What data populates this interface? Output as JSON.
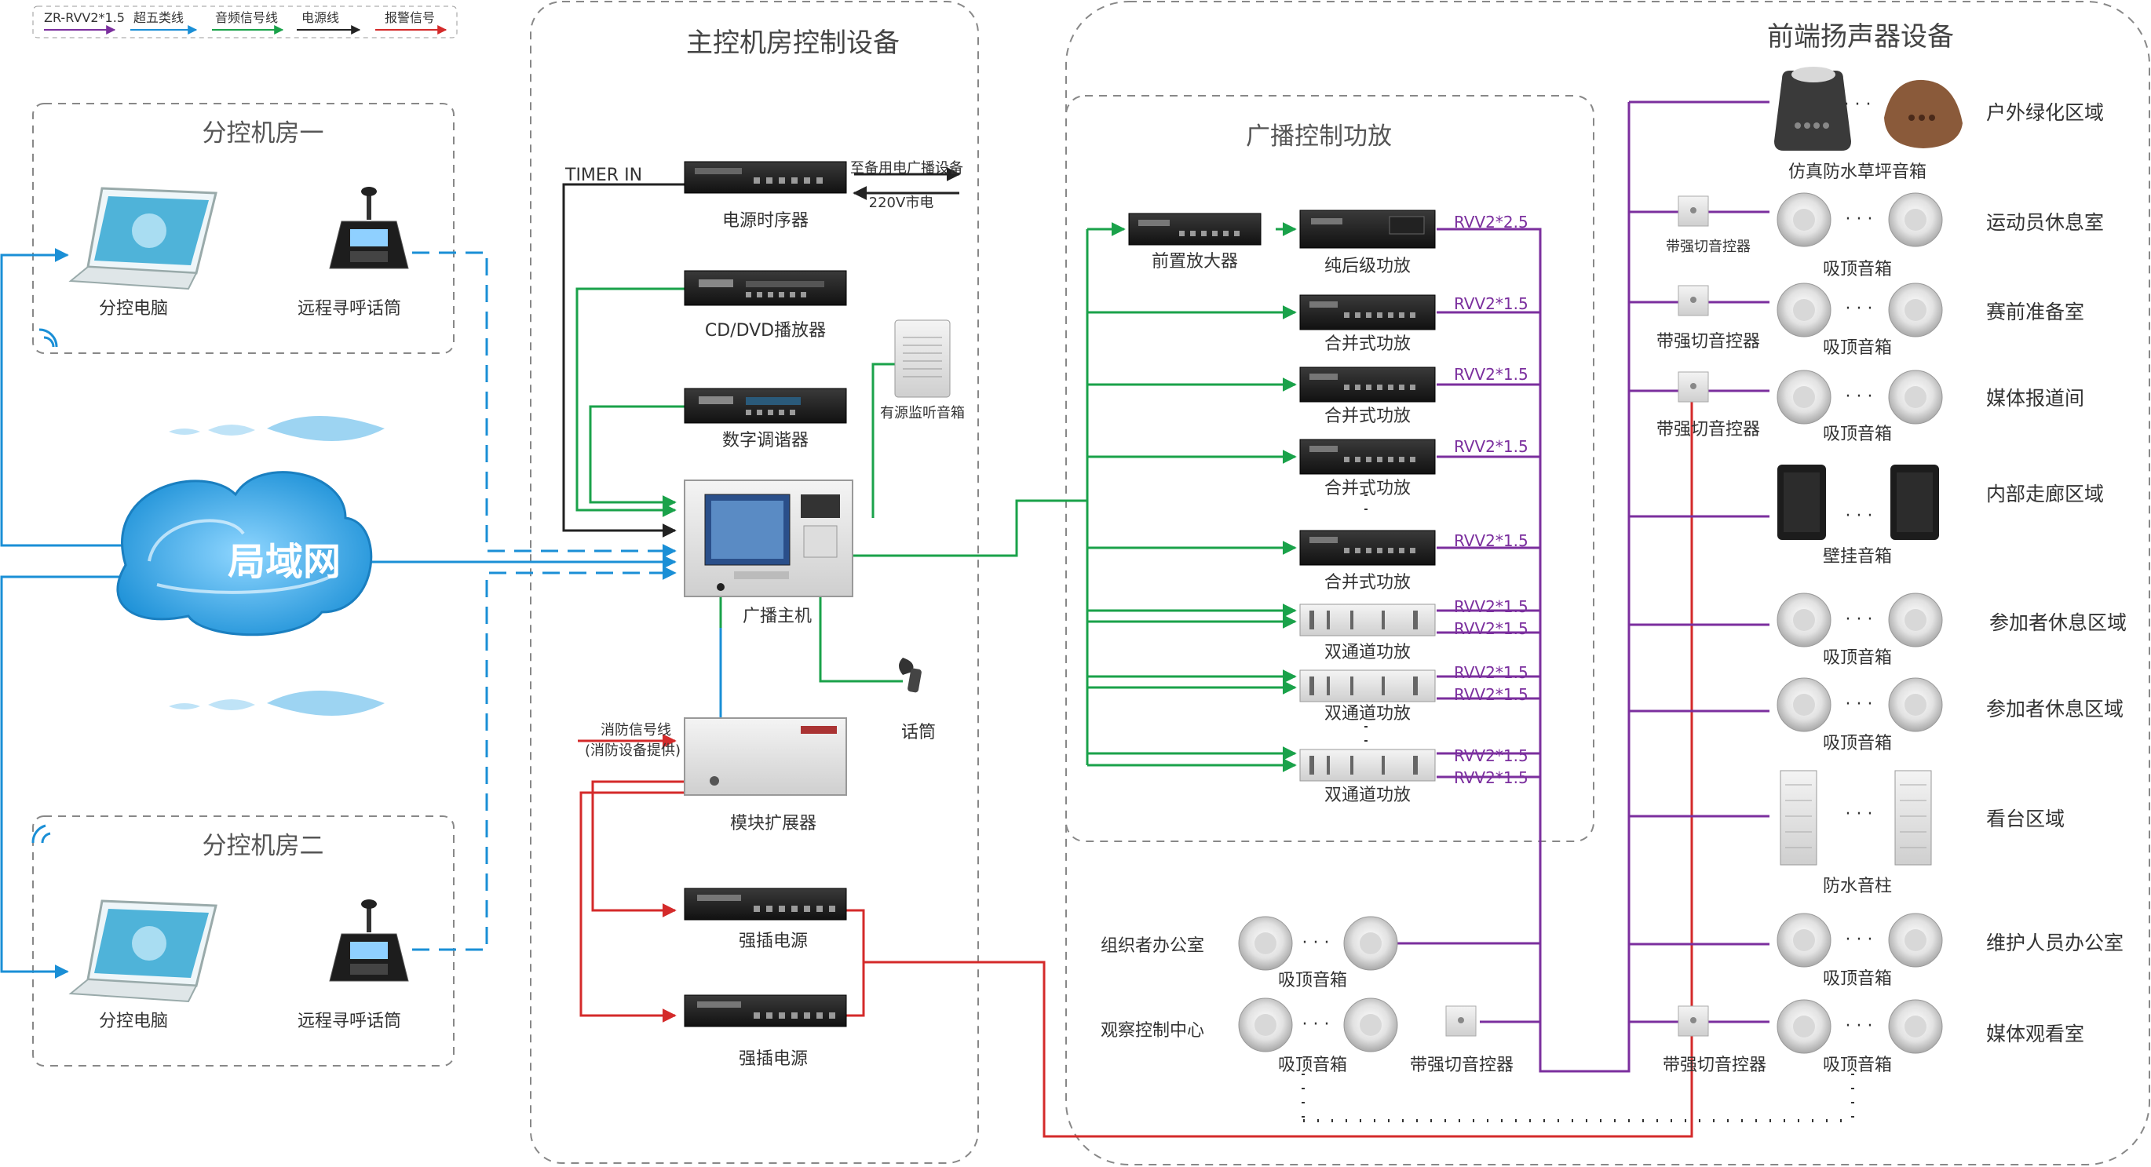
{
  "legend": {
    "items": [
      {
        "label": "ZR-RVV2*1.5",
        "color": "#7b2f9e"
      },
      {
        "label": "超五类线",
        "color": "#1a8fd6"
      },
      {
        "label": "音频信号线",
        "color": "#1aa24a"
      },
      {
        "label": "电源线",
        "color": "#222222"
      },
      {
        "label": "报警信号",
        "color": "#d42a2a"
      }
    ]
  },
  "sections": {
    "sub_room_1": "分控机房一",
    "sub_room_2": "分控机房二",
    "main_room": "主控机房控制设备",
    "front_end": "前端扬声器设备",
    "amp_control": "广播控制功放"
  },
  "lan_label": "局域网",
  "sub_room_devices": {
    "pc": "分控电脑",
    "mic": "远程寻呼话筒"
  },
  "main_devices": {
    "timer_in": "TIMER IN",
    "power_sequencer": "电源时序器",
    "backup_note": "至备用电广播设备",
    "mains_note": "220V市电",
    "cd_player": "CD/DVD播放器",
    "tuner": "数字调谐器",
    "monitor_speaker": "有源监听音箱",
    "host": "广播主机",
    "mic": "话筒",
    "fire_signal": "消防信号线",
    "fire_provided": "(消防设备提供)",
    "expander": "模块扩展器",
    "power_socket_1": "强插电源",
    "power_socket_2": "强插电源"
  },
  "amp_devices": {
    "preamp": "前置放大器",
    "pure_power": "纯后级功放",
    "mixer_amp": "合并式功放",
    "dual_amp": "双通道功放",
    "cable_25": "RVV2*2.5",
    "cable_15": "RVV2*1.5",
    "dots": "·"
  },
  "speakers": {
    "lawn": "仿真防水草坪音箱",
    "ceiling": "吸顶音箱",
    "wall": "壁挂音箱",
    "column": "防水音柱",
    "cutter": "带强切音控器",
    "dots": "· · ·"
  },
  "zones": {
    "z1": "户外绿化区域",
    "z2": "运动员休息室",
    "z3": "赛前准备室",
    "z4": "媒体报道间",
    "z5": "内部走廊区域",
    "z6": "参加者休息区域",
    "z7": "参加者休息区域",
    "z8": "看台区域",
    "z9": "维护人员办公室",
    "z10": "媒体观看室",
    "office_left": "组织者办公室",
    "center_left": "观察控制中心"
  }
}
